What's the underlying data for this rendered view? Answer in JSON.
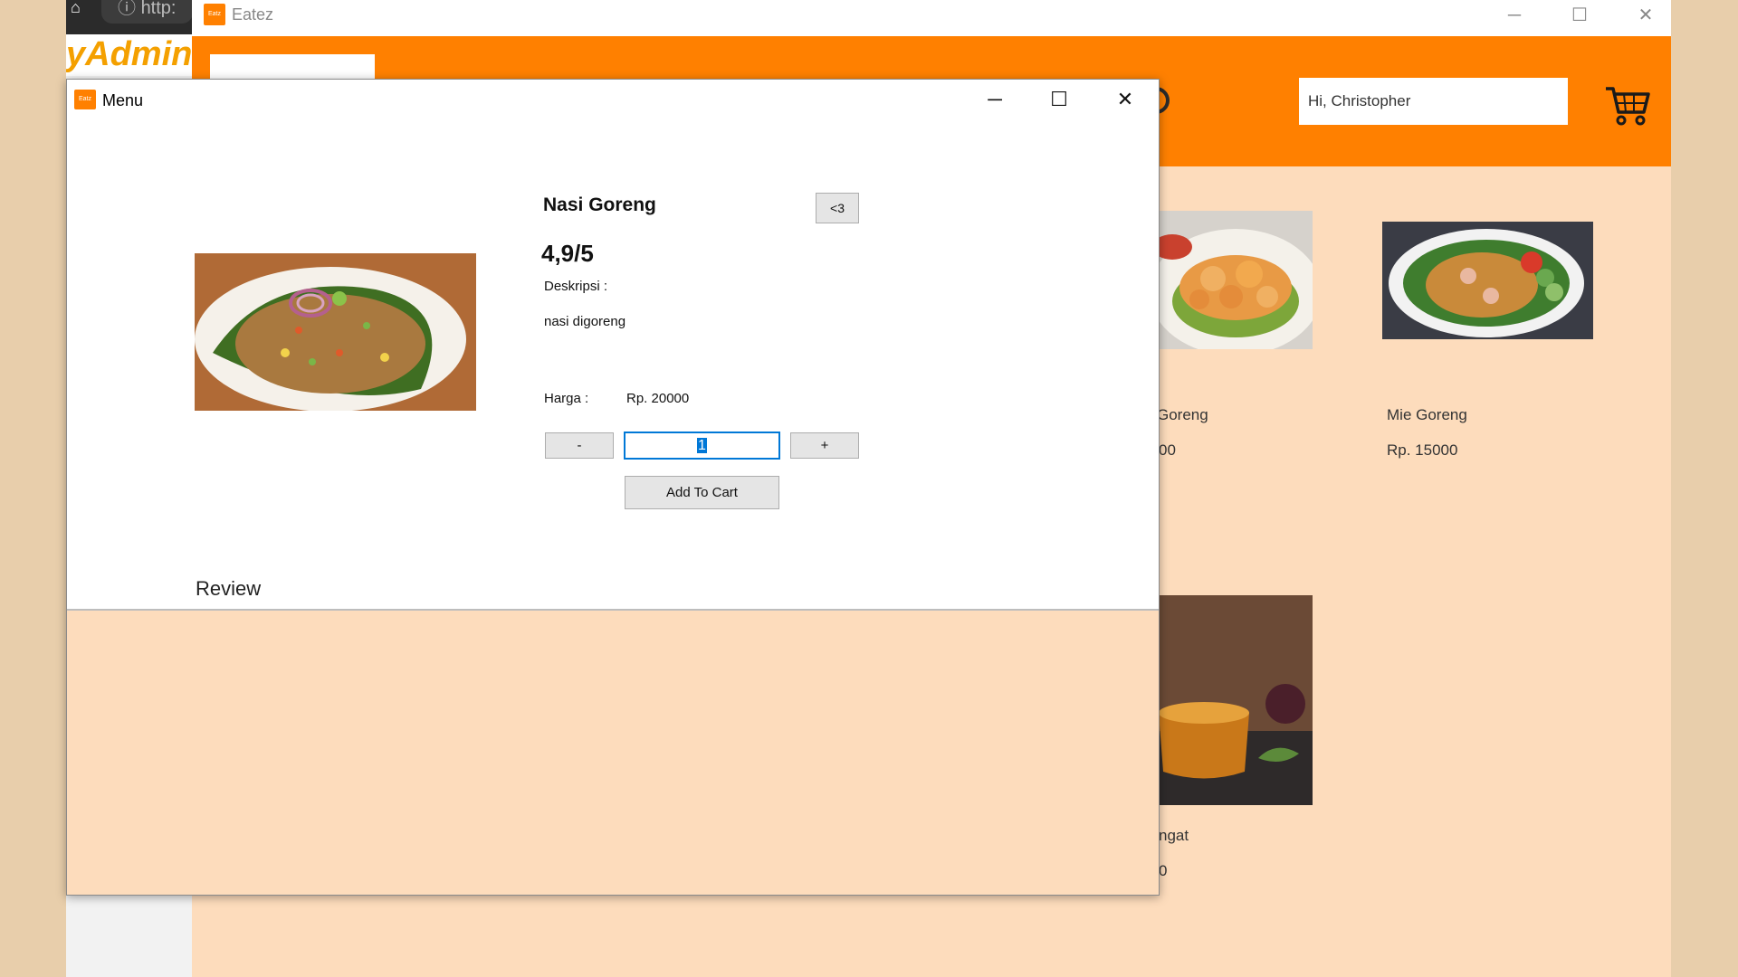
{
  "browser": {
    "url_fragment": "http:",
    "admin_logo_text": "yAdmin"
  },
  "eatez": {
    "title": "Eatez",
    "logo_text": "Eatz",
    "greeting": "Hi, Christopher",
    "food_cards": [
      {
        "name_fragment": "Goreng",
        "price_fragment": "00"
      },
      {
        "name": "Mie Goreng",
        "price": "Rp. 15000"
      },
      {
        "name_fragment": "ngat",
        "price_fragment": "0"
      }
    ]
  },
  "menu_dialog": {
    "title": "Menu",
    "logo_text": "Eatz",
    "food_name": "Nasi Goreng",
    "like_label": "<3",
    "rating": "4,9/5",
    "description_label": "Deskripsi :",
    "description": "nasi digoreng",
    "price_label": "Harga :",
    "price": "Rp. 20000",
    "minus_label": "-",
    "quantity": "1",
    "plus_label": "+",
    "add_to_cart_label": "Add To Cart",
    "review_heading": "Review"
  },
  "colors": {
    "brand_orange": "#ff8000",
    "background_peach": "#fddcbc",
    "selection_blue": "#0078d7"
  }
}
